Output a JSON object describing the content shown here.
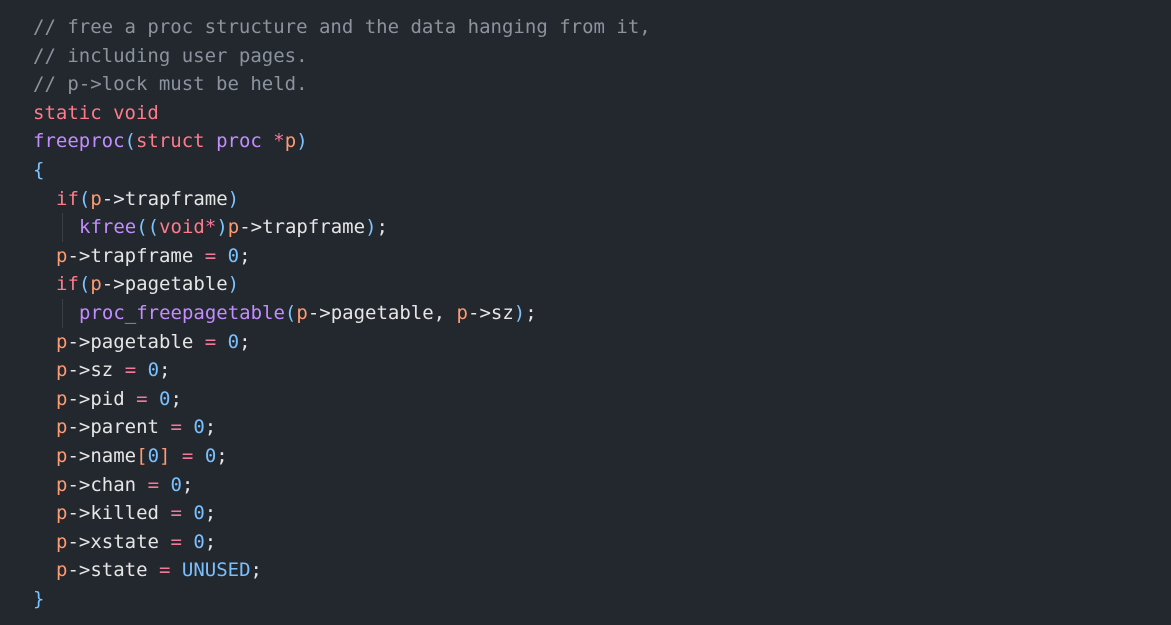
{
  "colors": {
    "background": "#23272e",
    "comment": "#8b949e",
    "keyword": "#ff7b8a",
    "function": "#c38dff",
    "punctuation": "#7cc4ff",
    "identifier": "#e6e6e6",
    "variable": "#ff9b73",
    "number": "#79c0ff"
  },
  "code": {
    "lines": [
      {
        "indent": 0,
        "tokens": [
          {
            "t": "// free a proc structure and the data hanging from it,",
            "k": "comment"
          }
        ]
      },
      {
        "indent": 0,
        "tokens": [
          {
            "t": "// including user pages.",
            "k": "comment"
          }
        ]
      },
      {
        "indent": 0,
        "tokens": [
          {
            "t": "// p->lock must be held.",
            "k": "comment"
          }
        ]
      },
      {
        "indent": 0,
        "tokens": [
          {
            "t": "static",
            "k": "keyword"
          },
          {
            "t": " ",
            "k": "ident"
          },
          {
            "t": "void",
            "k": "keyword"
          }
        ]
      },
      {
        "indent": 0,
        "tokens": [
          {
            "t": "freeproc",
            "k": "func"
          },
          {
            "t": "(",
            "k": "punct"
          },
          {
            "t": "struct",
            "k": "keyword"
          },
          {
            "t": " ",
            "k": "ident"
          },
          {
            "t": "proc",
            "k": "type"
          },
          {
            "t": " ",
            "k": "ident"
          },
          {
            "t": "*",
            "k": "op"
          },
          {
            "t": "p",
            "k": "var"
          },
          {
            "t": ")",
            "k": "punct"
          }
        ]
      },
      {
        "indent": 0,
        "tokens": [
          {
            "t": "{",
            "k": "punct"
          }
        ]
      },
      {
        "indent": 1,
        "tokens": [
          {
            "t": "if",
            "k": "keyword"
          },
          {
            "t": "(",
            "k": "punct"
          },
          {
            "t": "p",
            "k": "var"
          },
          {
            "t": "->",
            "k": "ident"
          },
          {
            "t": "trapframe",
            "k": "ident"
          },
          {
            "t": ")",
            "k": "punct"
          }
        ]
      },
      {
        "indent": 2,
        "guide": true,
        "tokens": [
          {
            "t": "kfree",
            "k": "func"
          },
          {
            "t": "((",
            "k": "punct"
          },
          {
            "t": "void",
            "k": "keyword"
          },
          {
            "t": "*",
            "k": "op"
          },
          {
            "t": ")",
            "k": "punct"
          },
          {
            "t": "p",
            "k": "var"
          },
          {
            "t": "->",
            "k": "ident"
          },
          {
            "t": "trapframe",
            "k": "ident"
          },
          {
            "t": ")",
            "k": "punct"
          },
          {
            "t": ";",
            "k": "ident"
          }
        ]
      },
      {
        "indent": 1,
        "tokens": [
          {
            "t": "p",
            "k": "var"
          },
          {
            "t": "->",
            "k": "ident"
          },
          {
            "t": "trapframe",
            "k": "ident"
          },
          {
            "t": " ",
            "k": "ident"
          },
          {
            "t": "=",
            "k": "op"
          },
          {
            "t": " ",
            "k": "ident"
          },
          {
            "t": "0",
            "k": "num"
          },
          {
            "t": ";",
            "k": "ident"
          }
        ]
      },
      {
        "indent": 1,
        "tokens": [
          {
            "t": "if",
            "k": "keyword"
          },
          {
            "t": "(",
            "k": "punct"
          },
          {
            "t": "p",
            "k": "var"
          },
          {
            "t": "->",
            "k": "ident"
          },
          {
            "t": "pagetable",
            "k": "ident"
          },
          {
            "t": ")",
            "k": "punct"
          }
        ]
      },
      {
        "indent": 2,
        "guide": true,
        "tokens": [
          {
            "t": "proc_freepagetable",
            "k": "func"
          },
          {
            "t": "(",
            "k": "punct"
          },
          {
            "t": "p",
            "k": "var"
          },
          {
            "t": "->",
            "k": "ident"
          },
          {
            "t": "pagetable",
            "k": "ident"
          },
          {
            "t": ", ",
            "k": "ident"
          },
          {
            "t": "p",
            "k": "var"
          },
          {
            "t": "->",
            "k": "ident"
          },
          {
            "t": "sz",
            "k": "ident"
          },
          {
            "t": ")",
            "k": "punct"
          },
          {
            "t": ";",
            "k": "ident"
          }
        ]
      },
      {
        "indent": 1,
        "tokens": [
          {
            "t": "p",
            "k": "var"
          },
          {
            "t": "->",
            "k": "ident"
          },
          {
            "t": "pagetable",
            "k": "ident"
          },
          {
            "t": " ",
            "k": "ident"
          },
          {
            "t": "=",
            "k": "op"
          },
          {
            "t": " ",
            "k": "ident"
          },
          {
            "t": "0",
            "k": "num"
          },
          {
            "t": ";",
            "k": "ident"
          }
        ]
      },
      {
        "indent": 1,
        "tokens": [
          {
            "t": "p",
            "k": "var"
          },
          {
            "t": "->",
            "k": "ident"
          },
          {
            "t": "sz",
            "k": "ident"
          },
          {
            "t": " ",
            "k": "ident"
          },
          {
            "t": "=",
            "k": "op"
          },
          {
            "t": " ",
            "k": "ident"
          },
          {
            "t": "0",
            "k": "num"
          },
          {
            "t": ";",
            "k": "ident"
          }
        ]
      },
      {
        "indent": 1,
        "tokens": [
          {
            "t": "p",
            "k": "var"
          },
          {
            "t": "->",
            "k": "ident"
          },
          {
            "t": "pid",
            "k": "ident"
          },
          {
            "t": " ",
            "k": "ident"
          },
          {
            "t": "=",
            "k": "op"
          },
          {
            "t": " ",
            "k": "ident"
          },
          {
            "t": "0",
            "k": "num"
          },
          {
            "t": ";",
            "k": "ident"
          }
        ]
      },
      {
        "indent": 1,
        "tokens": [
          {
            "t": "p",
            "k": "var"
          },
          {
            "t": "->",
            "k": "ident"
          },
          {
            "t": "parent",
            "k": "ident"
          },
          {
            "t": " ",
            "k": "ident"
          },
          {
            "t": "=",
            "k": "op"
          },
          {
            "t": " ",
            "k": "ident"
          },
          {
            "t": "0",
            "k": "num"
          },
          {
            "t": ";",
            "k": "ident"
          }
        ]
      },
      {
        "indent": 1,
        "tokens": [
          {
            "t": "p",
            "k": "var"
          },
          {
            "t": "->",
            "k": "ident"
          },
          {
            "t": "name",
            "k": "ident"
          },
          {
            "t": "[",
            "k": "var"
          },
          {
            "t": "0",
            "k": "num"
          },
          {
            "t": "]",
            "k": "var"
          },
          {
            "t": " ",
            "k": "ident"
          },
          {
            "t": "=",
            "k": "op"
          },
          {
            "t": " ",
            "k": "ident"
          },
          {
            "t": "0",
            "k": "num"
          },
          {
            "t": ";",
            "k": "ident"
          }
        ]
      },
      {
        "indent": 1,
        "tokens": [
          {
            "t": "p",
            "k": "var"
          },
          {
            "t": "->",
            "k": "ident"
          },
          {
            "t": "chan",
            "k": "ident"
          },
          {
            "t": " ",
            "k": "ident"
          },
          {
            "t": "=",
            "k": "op"
          },
          {
            "t": " ",
            "k": "ident"
          },
          {
            "t": "0",
            "k": "num"
          },
          {
            "t": ";",
            "k": "ident"
          }
        ]
      },
      {
        "indent": 1,
        "tokens": [
          {
            "t": "p",
            "k": "var"
          },
          {
            "t": "->",
            "k": "ident"
          },
          {
            "t": "killed",
            "k": "ident"
          },
          {
            "t": " ",
            "k": "ident"
          },
          {
            "t": "=",
            "k": "op"
          },
          {
            "t": " ",
            "k": "ident"
          },
          {
            "t": "0",
            "k": "num"
          },
          {
            "t": ";",
            "k": "ident"
          }
        ]
      },
      {
        "indent": 1,
        "tokens": [
          {
            "t": "p",
            "k": "var"
          },
          {
            "t": "->",
            "k": "ident"
          },
          {
            "t": "xstate",
            "k": "ident"
          },
          {
            "t": " ",
            "k": "ident"
          },
          {
            "t": "=",
            "k": "op"
          },
          {
            "t": " ",
            "k": "ident"
          },
          {
            "t": "0",
            "k": "num"
          },
          {
            "t": ";",
            "k": "ident"
          }
        ]
      },
      {
        "indent": 1,
        "tokens": [
          {
            "t": "p",
            "k": "var"
          },
          {
            "t": "->",
            "k": "ident"
          },
          {
            "t": "state",
            "k": "ident"
          },
          {
            "t": " ",
            "k": "ident"
          },
          {
            "t": "=",
            "k": "op"
          },
          {
            "t": " ",
            "k": "ident"
          },
          {
            "t": "UNUSED",
            "k": "const"
          },
          {
            "t": ";",
            "k": "ident"
          }
        ]
      },
      {
        "indent": 0,
        "tokens": [
          {
            "t": "}",
            "k": "punct"
          }
        ]
      }
    ]
  }
}
